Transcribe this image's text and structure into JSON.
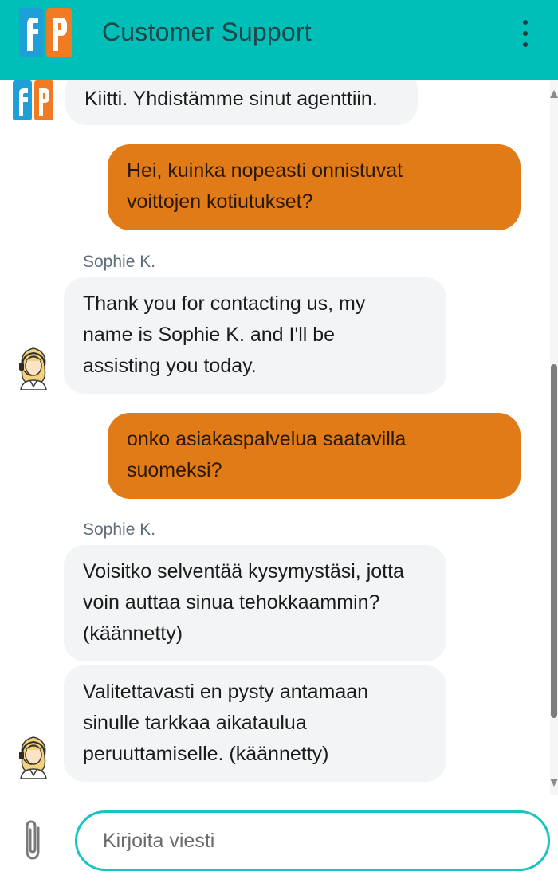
{
  "header": {
    "title": "Customer Support",
    "logo_text": "fp",
    "brand_colors": {
      "header_bg": "#00bfb9",
      "logo_blue": "#1f9fd8",
      "logo_orange": "#f07b23",
      "user_bubble": "#e07b18",
      "input_border": "#18c4c0"
    }
  },
  "messages": [
    {
      "type": "bot",
      "text": "Kiitti. Yhdistämme sinut agenttiin."
    },
    {
      "type": "user",
      "lines": [
        "Hei, kuinka nopeasti onnistuvat",
        "voittojen kotiutukset?"
      ]
    },
    {
      "type": "agent",
      "sender": "Sophie K.",
      "lines": [
        "Thank you for contacting us, my",
        "name is Sophie K. and I'll be",
        "assisting you today."
      ]
    },
    {
      "type": "user",
      "lines": [
        "onko asiakaspalvelua saatavilla",
        "suomeksi?"
      ]
    },
    {
      "type": "agent",
      "sender": "Sophie K.",
      "lines": [
        "Voisitko selventää kysymystäsi, jotta",
        "voin auttaa sinua tehokkaammin?",
        "(käännetty)"
      ]
    },
    {
      "type": "agent",
      "lines": [
        "Valitettavasti en pysty antamaan",
        "sinulle tarkkaa aikataulua",
        "peruuttamiselle. (käännetty)"
      ]
    }
  ],
  "composer": {
    "placeholder": "Kirjoita viesti",
    "value": ""
  },
  "icons": {
    "menu": "more-vertical-icon",
    "attach": "paperclip-icon",
    "agent": "agent-headset-avatar-icon"
  }
}
